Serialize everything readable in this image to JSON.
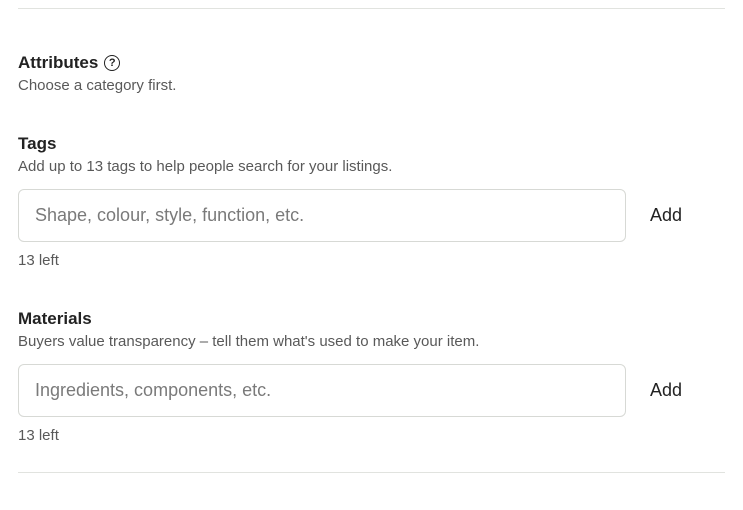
{
  "attributes": {
    "title": "Attributes",
    "desc": "Choose a category first."
  },
  "tags": {
    "title": "Tags",
    "desc": "Add up to 13 tags to help people search for your listings.",
    "placeholder": "Shape, colour, style, function, etc.",
    "add_label": "Add",
    "counter": "13 left"
  },
  "materials": {
    "title": "Materials",
    "desc": "Buyers value transparency – tell them what's used to make your item.",
    "placeholder": "Ingredients, components, etc.",
    "add_label": "Add",
    "counter": "13 left"
  }
}
